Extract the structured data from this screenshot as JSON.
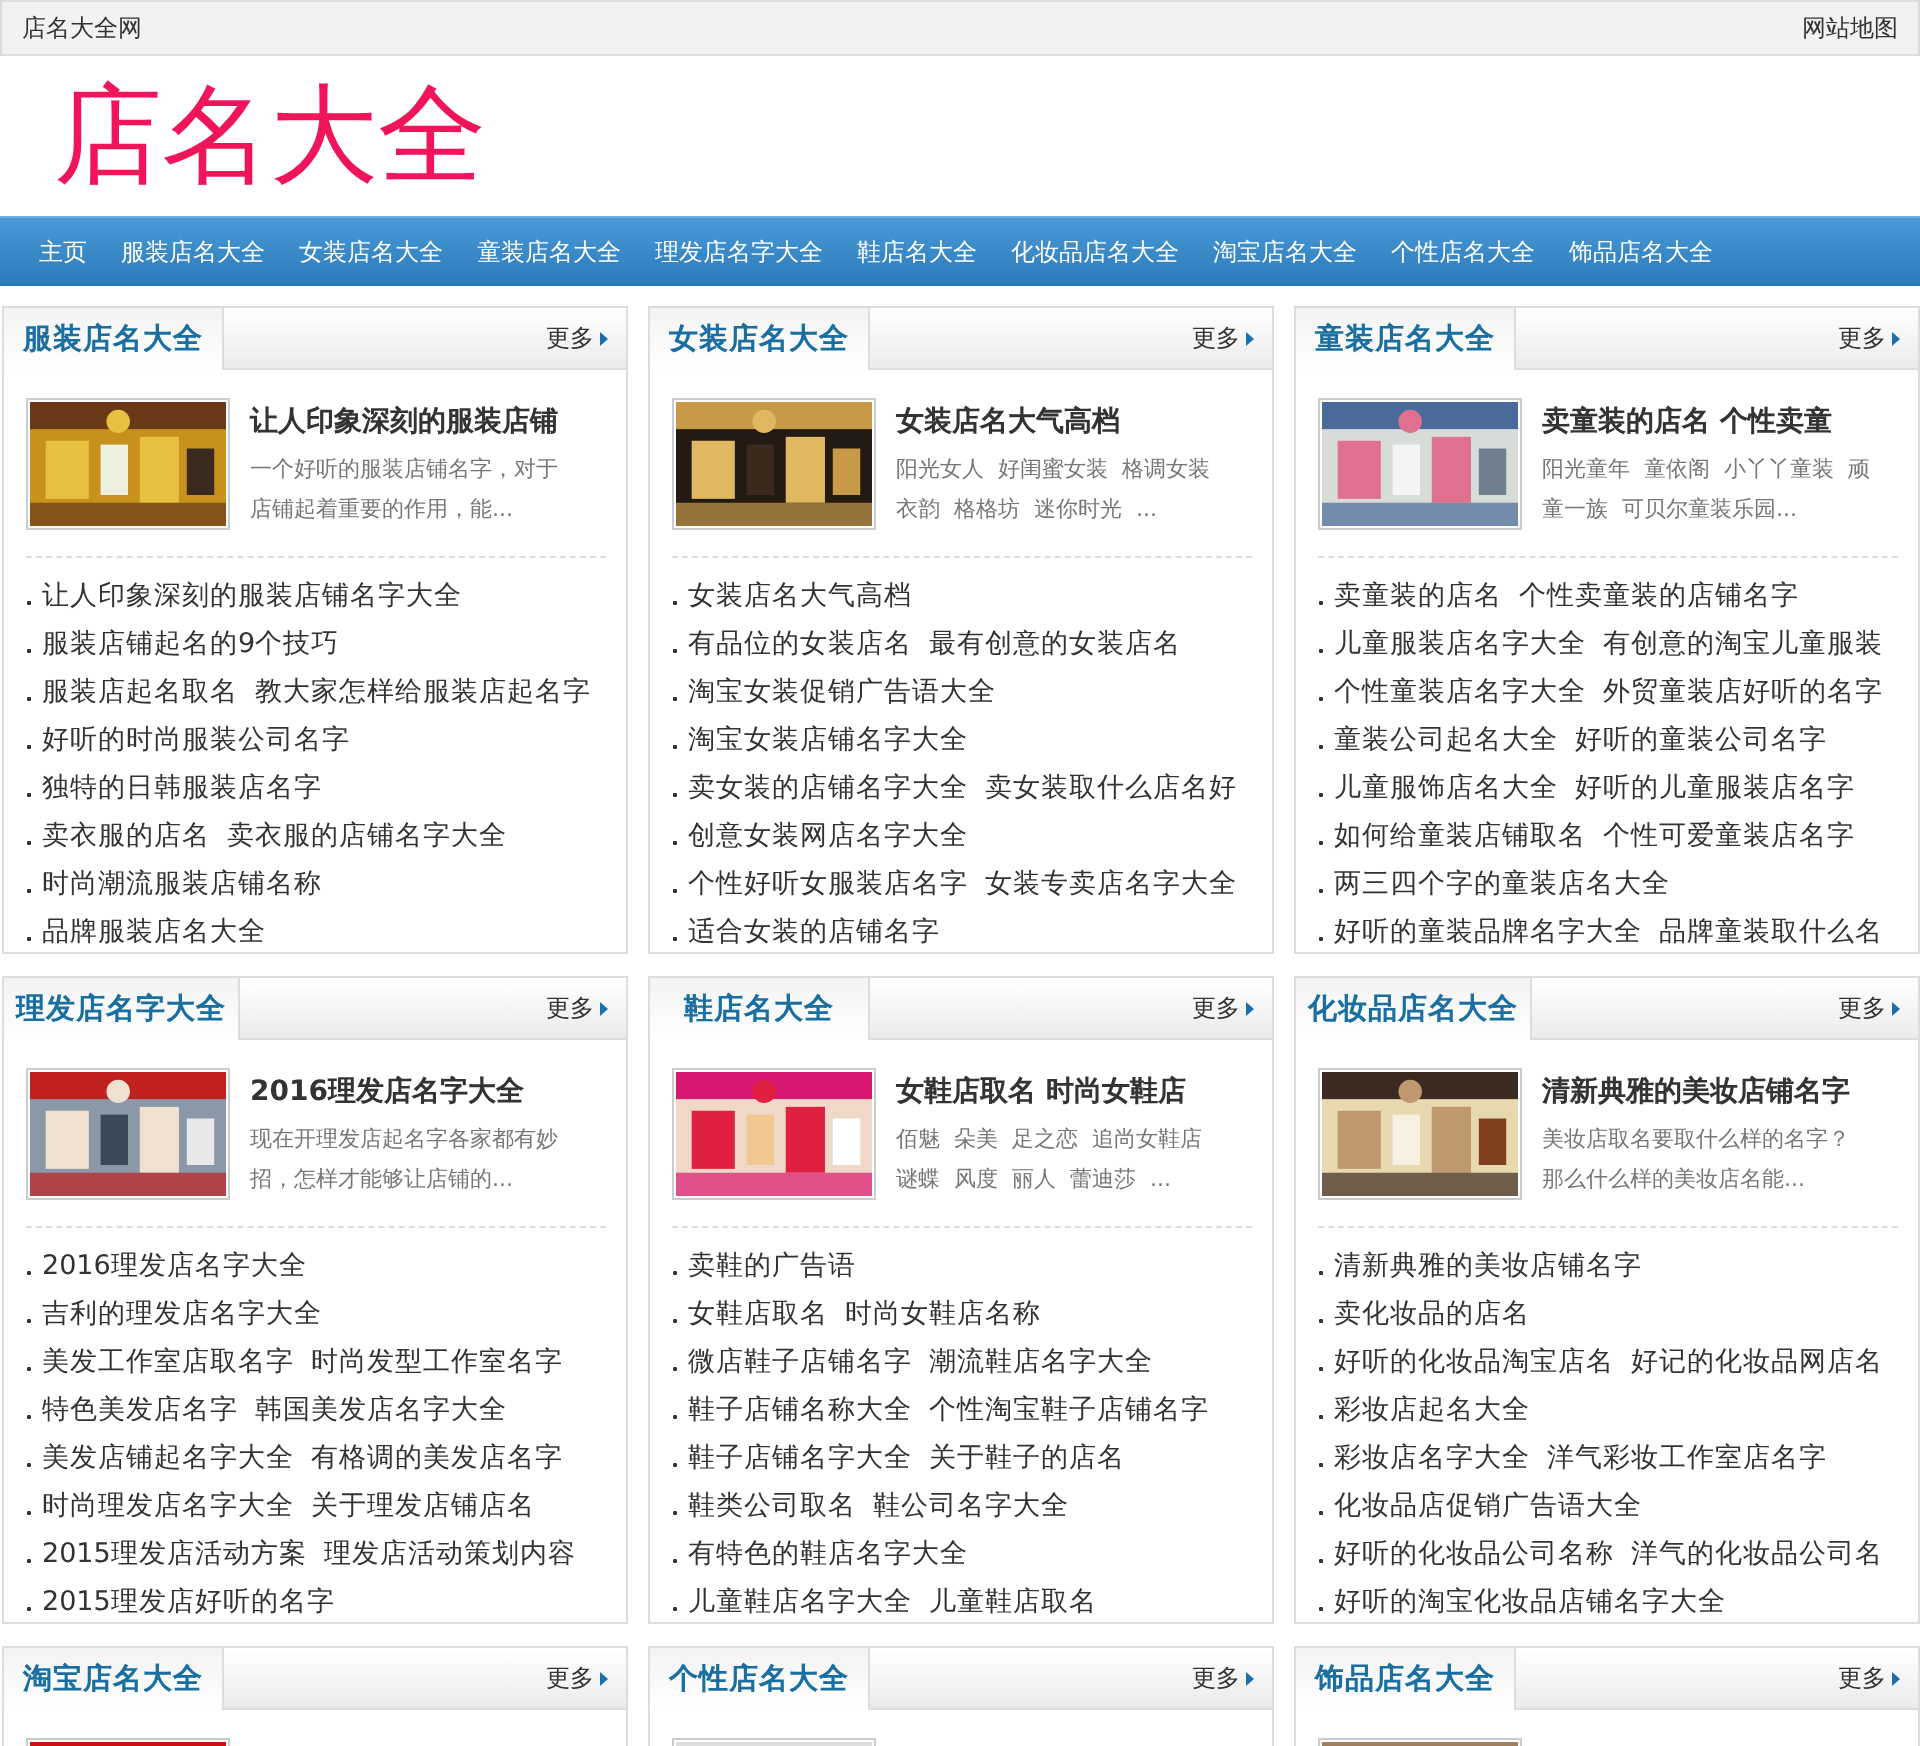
{
  "top_bar": {
    "site_name": "店名大全网",
    "sitemap": "网站地图"
  },
  "logo": "店名大全",
  "nav": [
    {
      "label": "主页",
      "selected": false
    },
    {
      "label": "服装店名大全",
      "selected": false
    },
    {
      "label": "女装店名大全",
      "selected": false
    },
    {
      "label": "童装店名大全",
      "selected": false
    },
    {
      "label": "理发店名字大全",
      "selected": false
    },
    {
      "label": "鞋店名大全",
      "selected": false
    },
    {
      "label": "化妆品店名大全",
      "selected": false
    },
    {
      "label": "淘宝店名大全",
      "selected": false
    },
    {
      "label": "个性店名大全",
      "selected": false
    },
    {
      "label": "饰品店名大全",
      "selected": false
    }
  ],
  "sections": [
    {
      "title": "服装店名大全",
      "more": "更多",
      "feature": {
        "kind": "picture",
        "title": "让人印象深刻的服装店铺",
        "desc": [
          "一个好听的服装店铺名字，对于",
          "店铺起着重要的作用，能..."
        ]
      },
      "links": [
        "让人印象深刻的服装店铺名字大全",
        "服装店铺起名的9个技巧",
        "服装店起名取名  教大家怎样给服装店起名字",
        "好听的时尚服装公司名字",
        "独特的日韩服装店名字",
        "卖衣服的店名  卖衣服的店铺名字大全",
        "时尚潮流服装店铺名称",
        "品牌服装店名大全"
      ]
    },
    {
      "title": "女装店名大全",
      "more": "更多",
      "feature": {
        "kind": "picture",
        "title": "女装店名大气高档",
        "desc": [
          "阳光女人  好闺蜜女装  格调女装",
          "衣韵  格格坊  迷你时光  ..."
        ]
      },
      "links": [
        "女装店名大气高档",
        "有品位的女装店名  最有创意的女装店名",
        "淘宝女装促销广告语大全",
        "淘宝女装店铺名字大全",
        "卖女装的店铺名字大全  卖女装取什么店名好",
        "创意女装网店名字大全",
        "个性好听女服装店名字  女装专卖店名字大全",
        "适合女装的店铺名字"
      ]
    },
    {
      "title": "童装店名大全",
      "more": "更多",
      "feature": {
        "kind": "picture",
        "title": "卖童装的店名  个性卖童",
        "desc": [
          "阳光童年  童依阁  小丫丫童装  顽",
          "童一族  可贝尔童装乐园..."
        ]
      },
      "links": [
        "卖童装的店名  个性卖童装的店铺名字",
        "儿童服装店名字大全  有创意的淘宝儿童服装",
        "个性童装店名字大全  外贸童装店好听的名字",
        "童装公司起名大全  好听的童装公司名字",
        "儿童服饰店名大全  好听的儿童服装店名字",
        "如何给童装店铺取名  个性可爱童装店名字",
        "两三四个字的童装店名大全",
        "好听的童装品牌名字大全  品牌童装取什么名"
      ]
    },
    {
      "title": "理发店名字大全",
      "more": "更多",
      "feature": {
        "kind": "picture",
        "title": "2016理发店名字大全",
        "desc": [
          "现在开理发店起名字各家都有妙",
          "招，怎样才能够让店铺的..."
        ]
      },
      "links": [
        "2016理发店名字大全",
        "吉利的理发店名字大全",
        "美发工作室店取名字  时尚发型工作室名字",
        "特色美发店名字  韩国美发店名字大全",
        "美发店铺起名字大全  有格调的美发店名字",
        "时尚理发店名字大全  关于理发店铺店名",
        "2015理发店活动方案  理发店活动策划内容",
        "2015理发店好听的名字"
      ]
    },
    {
      "title": "鞋店名大全",
      "more": "更多",
      "feature": {
        "kind": "picture",
        "title": "女鞋店取名  时尚女鞋店",
        "desc": [
          "佰魅  朵美  足之恋  追尚女鞋店",
          "谜蝶  风度  丽人  蕾迪莎  ..."
        ]
      },
      "links": [
        "卖鞋的广告语",
        "女鞋店取名  时尚女鞋店名称",
        "微店鞋子店铺名字  潮流鞋店名字大全",
        "鞋子店铺名称大全  个性淘宝鞋子店铺名字",
        "鞋子店铺名字大全  关于鞋子的店名",
        "鞋类公司取名  鞋公司名字大全",
        "有特色的鞋店名字大全",
        "儿童鞋店名字大全  儿童鞋店取名"
      ]
    },
    {
      "title": "化妆品店名大全",
      "more": "更多",
      "feature": {
        "kind": "picture",
        "title": "清新典雅的美妆店铺名字",
        "desc": [
          "美妆店取名要取什么样的名字？",
          "那么什么样的美妆店名能..."
        ]
      },
      "links": [
        "清新典雅的美妆店铺名字",
        "卖化妆品的店名",
        "好听的化妆品淘宝店名  好记的化妆品网店名",
        "彩妆店起名大全",
        "彩妆店名字大全  洋气彩妆工作室店名字",
        "化妆品店促销广告语大全",
        "好听的化妆品公司名称  洋气的化妆品公司名",
        "好听的淘宝化妆品店铺名字大全"
      ]
    },
    {
      "title": "淘宝店名大全",
      "more": "更多"
    },
    {
      "title": "个性店名大全",
      "more": "更多"
    },
    {
      "title": "饰品店名大全",
      "more": "更多"
    }
  ]
}
